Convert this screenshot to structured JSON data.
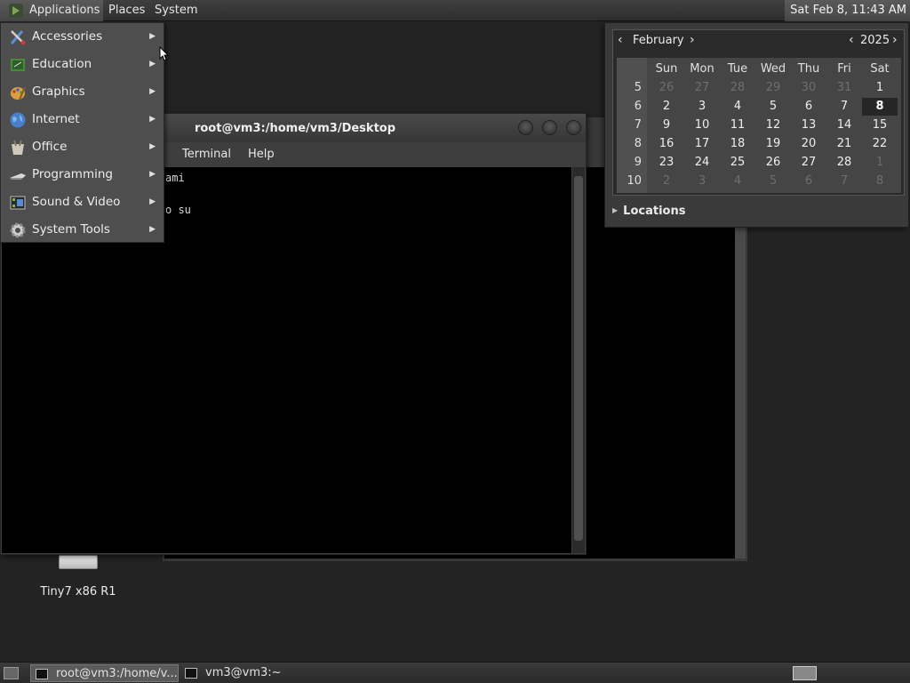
{
  "top_panel": {
    "applications_label": "Applications",
    "places_label": "Places",
    "system_label": "System",
    "clock": "Sat Feb  8, 11:43 AM"
  },
  "app_menu": {
    "items": [
      {
        "label": "Accessories",
        "icon": "accessories-icon"
      },
      {
        "label": "Education",
        "icon": "education-icon"
      },
      {
        "label": "Graphics",
        "icon": "graphics-icon"
      },
      {
        "label": "Internet",
        "icon": "internet-icon"
      },
      {
        "label": "Office",
        "icon": "office-icon"
      },
      {
        "label": "Programming",
        "icon": "programming-icon"
      },
      {
        "label": "Sound & Video",
        "icon": "sound-video-icon"
      },
      {
        "label": "System Tools",
        "icon": "system-tools-icon"
      }
    ]
  },
  "terminal": {
    "title": "root@vm3:/home/vm3/Desktop",
    "menu": [
      "Terminal",
      "Help"
    ],
    "lines": [
      "ami",
      "o su"
    ]
  },
  "desktop_icon": {
    "label": "Tiny7 x86 R1"
  },
  "calendar": {
    "month": "February",
    "year": "2025",
    "day_headers": [
      "Sun",
      "Mon",
      "Tue",
      "Wed",
      "Thu",
      "Fri",
      "Sat"
    ],
    "weeks": [
      {
        "week": "5",
        "days": [
          {
            "d": "26",
            "dim": true
          },
          {
            "d": "27",
            "dim": true
          },
          {
            "d": "28",
            "dim": true
          },
          {
            "d": "29",
            "dim": true
          },
          {
            "d": "30",
            "dim": true
          },
          {
            "d": "31",
            "dim": true
          },
          {
            "d": "1"
          }
        ]
      },
      {
        "week": "6",
        "days": [
          {
            "d": "2"
          },
          {
            "d": "3"
          },
          {
            "d": "4"
          },
          {
            "d": "5"
          },
          {
            "d": "6"
          },
          {
            "d": "7"
          },
          {
            "d": "8",
            "today": true
          }
        ]
      },
      {
        "week": "7",
        "days": [
          {
            "d": "9"
          },
          {
            "d": "10"
          },
          {
            "d": "11"
          },
          {
            "d": "12"
          },
          {
            "d": "13"
          },
          {
            "d": "14"
          },
          {
            "d": "15"
          }
        ]
      },
      {
        "week": "8",
        "days": [
          {
            "d": "16"
          },
          {
            "d": "17"
          },
          {
            "d": "18"
          },
          {
            "d": "19"
          },
          {
            "d": "20"
          },
          {
            "d": "21"
          },
          {
            "d": "22"
          }
        ]
      },
      {
        "week": "9",
        "days": [
          {
            "d": "23"
          },
          {
            "d": "24"
          },
          {
            "d": "25"
          },
          {
            "d": "26"
          },
          {
            "d": "27"
          },
          {
            "d": "28"
          },
          {
            "d": "1",
            "dim": true
          }
        ]
      },
      {
        "week": "10",
        "days": [
          {
            "d": "2",
            "dim": true
          },
          {
            "d": "3",
            "dim": true
          },
          {
            "d": "4",
            "dim": true
          },
          {
            "d": "5",
            "dim": true
          },
          {
            "d": "6",
            "dim": true
          },
          {
            "d": "7",
            "dim": true
          },
          {
            "d": "8",
            "dim": true
          }
        ]
      }
    ],
    "locations_label": "Locations"
  },
  "taskbar": {
    "tasks": [
      {
        "label": "root@vm3:/home/v...",
        "active": true
      },
      {
        "label": "vm3@vm3:~",
        "active": false
      }
    ]
  },
  "colors": {
    "desktop": "#232323",
    "menu_bg": "#4e4e4e",
    "today_bg": "#262626"
  }
}
